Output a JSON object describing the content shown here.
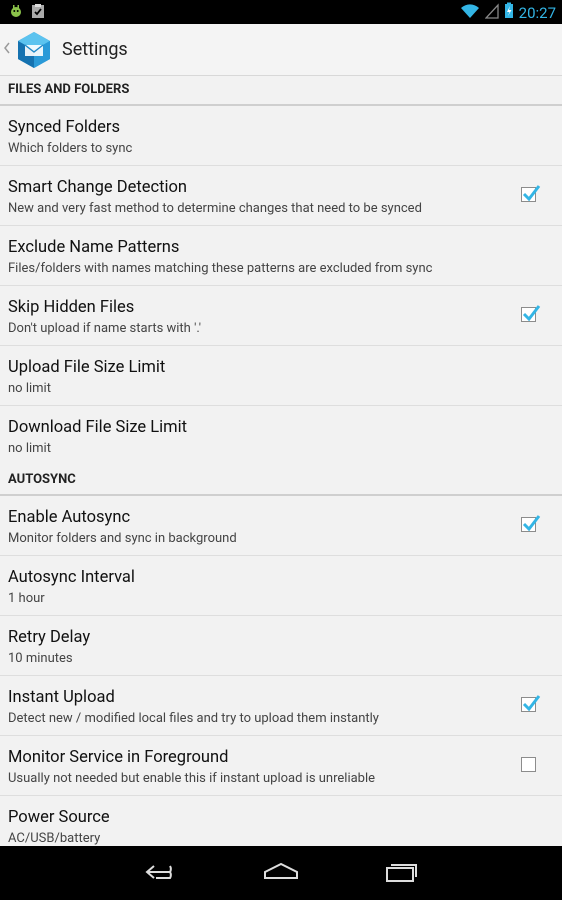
{
  "status": {
    "time": "20:27"
  },
  "actionbar": {
    "title": "Settings"
  },
  "sections": [
    {
      "header": "FILES AND FOLDERS"
    },
    {
      "header": "AUTOSYNC"
    }
  ],
  "prefs": [
    {
      "title": "Synced Folders",
      "summary": "Which folders to sync"
    },
    {
      "title": "Smart Change Detection",
      "summary": "New and very fast method to determine changes that need to be synced",
      "checked": true
    },
    {
      "title": "Exclude Name Patterns",
      "summary": "Files/folders with names matching these patterns are excluded from sync"
    },
    {
      "title": "Skip Hidden Files",
      "summary": "Don't upload if name starts with '.'",
      "checked": true
    },
    {
      "title": "Upload File Size Limit",
      "summary": "no limit"
    },
    {
      "title": "Download File Size Limit",
      "summary": "no limit"
    },
    {
      "title": "Enable Autosync",
      "summary": "Monitor folders and sync in background",
      "checked": true
    },
    {
      "title": "Autosync Interval",
      "summary": "1 hour"
    },
    {
      "title": "Retry Delay",
      "summary": "10 minutes"
    },
    {
      "title": "Instant Upload",
      "summary": "Detect new / modified local files and try to upload them instantly",
      "checked": true
    },
    {
      "title": "Monitor Service in Foreground",
      "summary": "Usually not needed but enable this if instant upload is unreliable",
      "checked": false
    },
    {
      "title": "Power Source",
      "summary": "AC/USB/battery"
    }
  ],
  "colors": {
    "accent": "#33b5e5",
    "background": "#f2f2f2",
    "statusbar": "#000000"
  }
}
